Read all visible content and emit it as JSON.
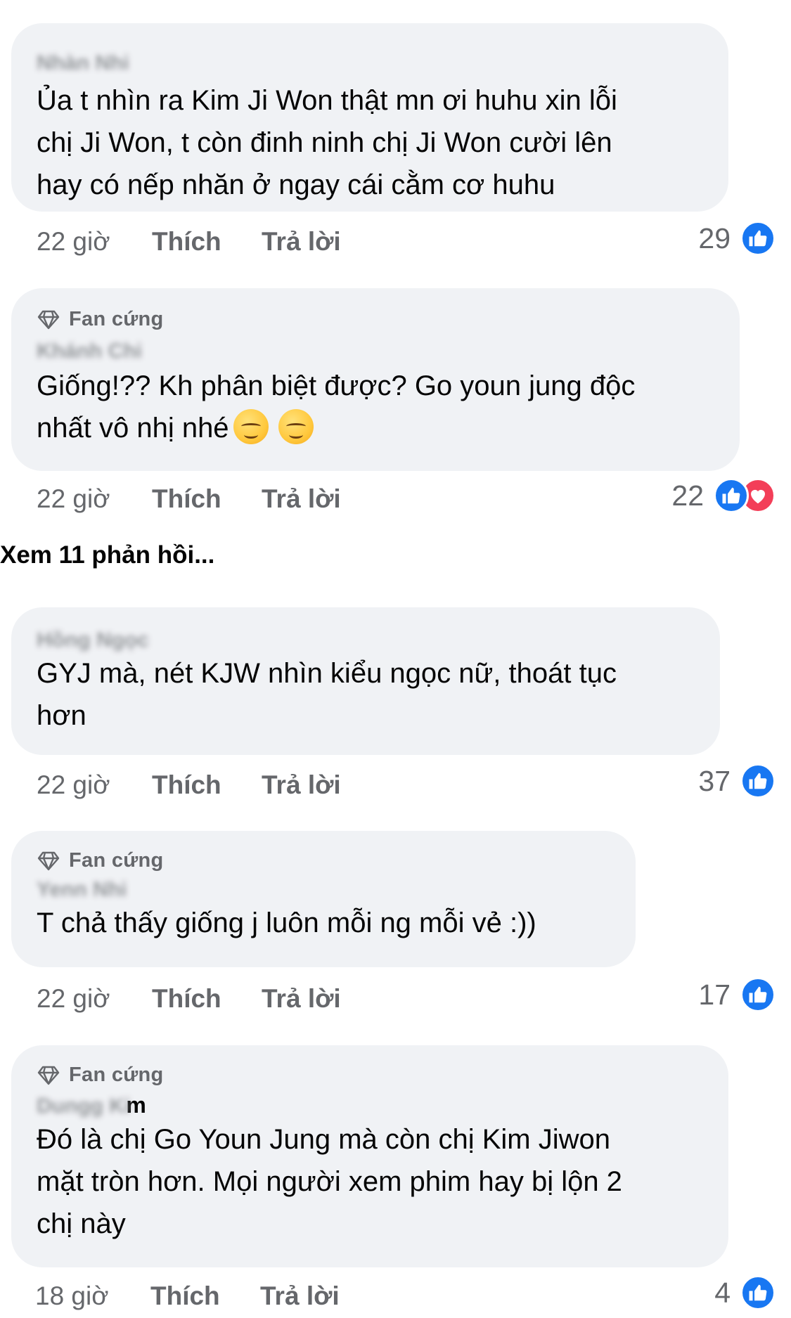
{
  "comments": [
    {
      "badge": "",
      "author": "Nhàn Nhi",
      "author_tail": "",
      "text": "Ủa t nhìn ra Kim Ji Won thật mn ơi huhu xin lỗi\nchị Ji Won, t còn  đinh ninh chị Ji Won cười lên\nhay có nếp nhăn ở ngay cái cằm cơ huhu",
      "time": "22 giờ",
      "like_label": "Thích",
      "reply_label": "Trả lời",
      "reaction_count": "29",
      "reactions": [
        "like-icon"
      ]
    },
    {
      "badge": "Fan cứng",
      "author": "Khánh Chi",
      "author_tail": "",
      "text": "Giống!?? Kh phân biệt được? Go youn jung độc\nnhất vô nhị nhé",
      "emojis": [
        "😌",
        "😌"
      ],
      "time": "22 giờ",
      "like_label": "Thích",
      "reply_label": "Trả lời",
      "reaction_count": "22",
      "reactions": [
        "like-icon",
        "love-icon"
      ]
    },
    {
      "badge": "",
      "author": "Hồng Ngọc",
      "author_tail": "",
      "text": "GYJ mà, nét KJW nhìn kiểu ngọc nữ, thoát tục\nhơn",
      "time": "22 giờ",
      "like_label": "Thích",
      "reply_label": "Trả lời",
      "reaction_count": "37",
      "reactions": [
        "like-icon"
      ]
    },
    {
      "badge": "Fan cứng",
      "author": "Yenn Nhi",
      "author_tail": "",
      "text": "T chả thấy giống j luôn mỗi ng mỗi vẻ :))",
      "time": "22 giờ",
      "like_label": "Thích",
      "reply_label": "Trả lời",
      "reaction_count": "17",
      "reactions": [
        "like-icon"
      ]
    },
    {
      "badge": "Fan cứng",
      "author": "Dungg Ki",
      "author_tail": "m",
      "text": "Đó là chị Go Youn Jung mà còn chị Kim Jiwon\nmặt tròn hơn. Mọi người xem phim hay bị lộn 2\nchị này",
      "time": "18 giờ",
      "like_label": "Thích",
      "reply_label": "Trả lời",
      "reaction_count": "4",
      "reactions": [
        "like-icon"
      ]
    }
  ],
  "view_replies": "Xem 11 phản hồi...",
  "colors": {
    "bubble": "#f0f2f5",
    "like": "#1877f2",
    "love": "#f33e58",
    "meta": "#65676b"
  }
}
